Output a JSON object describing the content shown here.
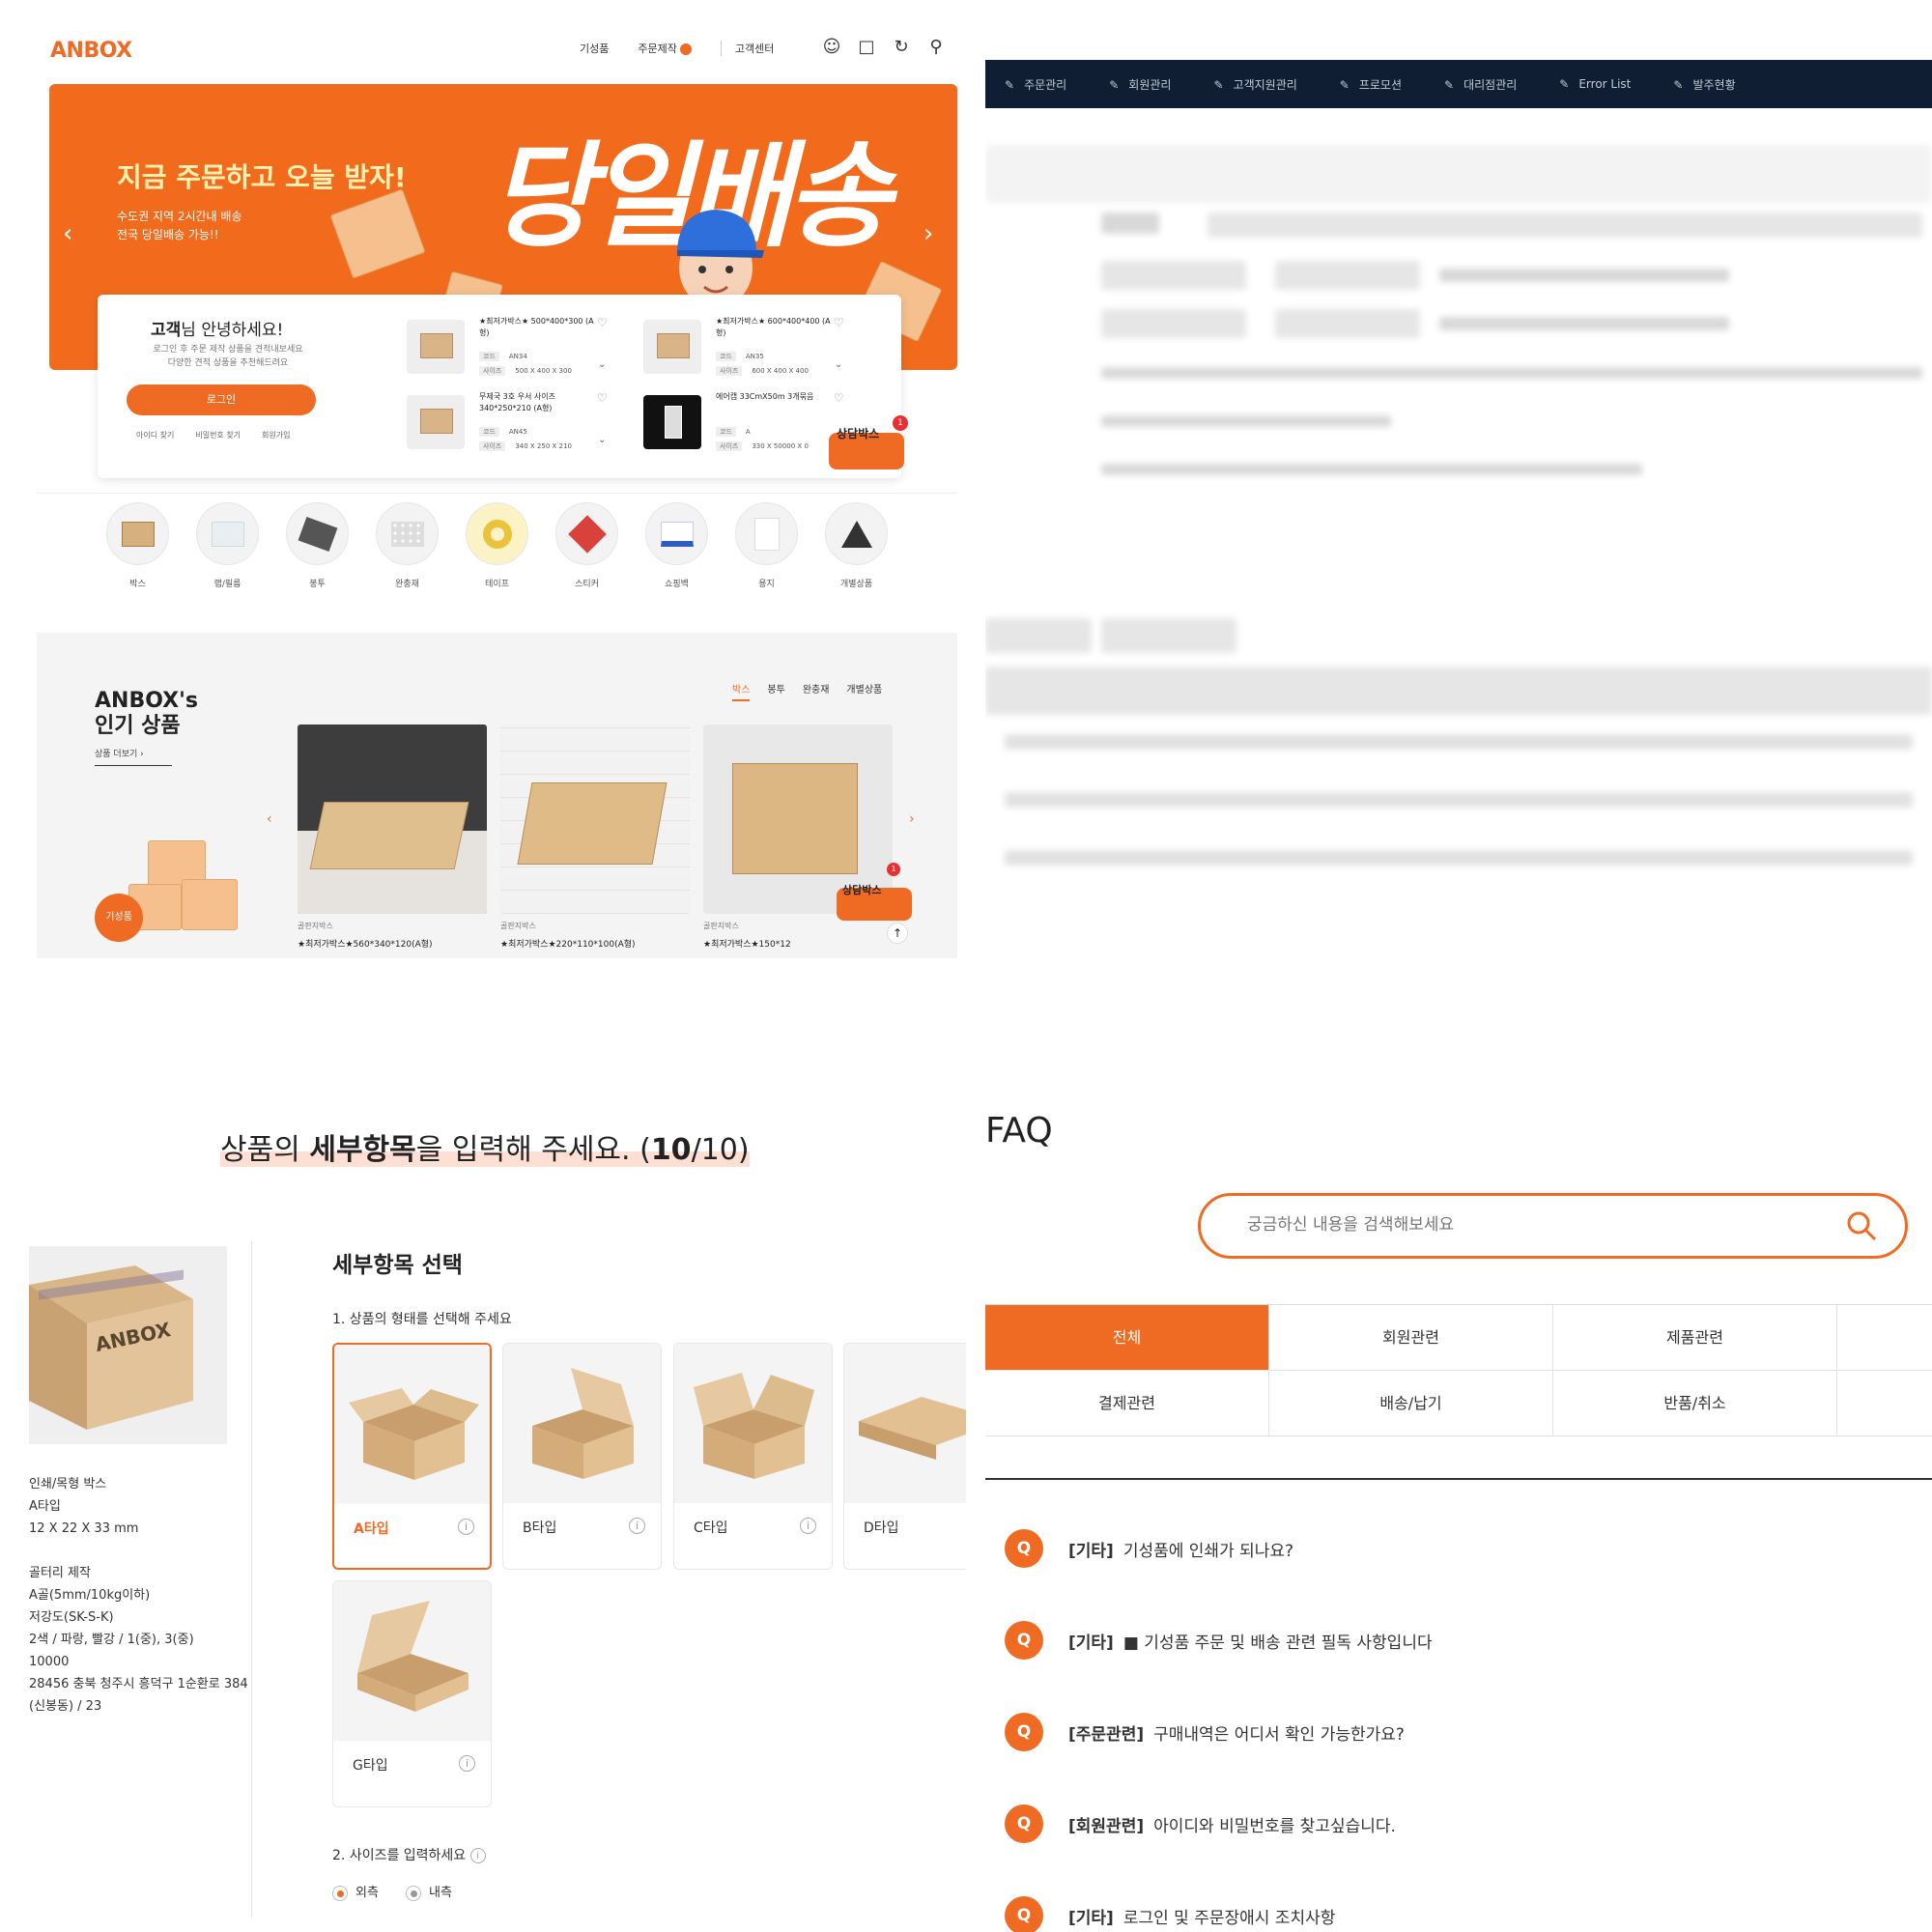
{
  "home": {
    "logo": "ANBOX",
    "nav": [
      "기성품",
      "주문제작",
      "고객센터"
    ],
    "banner": {
      "headline": "지금 주문하고 오늘 받자!",
      "sub": "수도권 지역 2시간내 배송\n전국 당일배송 가능!!",
      "big": "당일배송"
    },
    "login": {
      "greet_bold": "고객",
      "greet_rest": "님 안녕하세요!",
      "sub": "로그인 후 주문 제작 상품을 견적내보세요\n다양한 견적 상품을 추천해드려요",
      "button": "로그인",
      "links": [
        "아이디 찾기",
        "비밀번호 찾기",
        "회원가입"
      ]
    },
    "products": [
      {
        "title": "★최저가박스★ 500*400*300 (A형)",
        "code": "AN34",
        "size": "500 X 400 X 300"
      },
      {
        "title": "★최저가박스★ 600*400*400 (A형)",
        "code": "AN35",
        "size": "600 X 400 X 400"
      },
      {
        "title": "무제국 3호 우서 사이즈 340*250*210 (A형)",
        "code": "AN45",
        "size": "340 X 250 X 210"
      },
      {
        "title": "에어캡 33CmX50m 3개묶음",
        "code": "A",
        "size": "330 X 50000 X 0"
      }
    ],
    "meta_labels": {
      "code": "코드",
      "size": "사이즈"
    },
    "consult_badge": "상담박스",
    "notif_count": "1",
    "categories": [
      "박스",
      "랩/필름",
      "봉투",
      "완충재",
      "테이프",
      "스티커",
      "쇼핑백",
      "용지",
      "개별상품"
    ],
    "popular": {
      "title": "ANBOX's\n인기 상품",
      "more": "상품 더보기  ›",
      "tabs": [
        "박스",
        "봉투",
        "완충재",
        "개별상품"
      ],
      "giseong": "기성품",
      "items": [
        {
          "cat": "골판지박스",
          "name": "★최저가박스★560*340*120(A형)"
        },
        {
          "cat": "골판지박스",
          "name": "★최저가박스★220*110*100(A형)"
        },
        {
          "cat": "골판지박스",
          "name": "★최저가박스★150*12"
        }
      ]
    }
  },
  "admin": {
    "menu": [
      "주문관리",
      "회원관리",
      "고객지원관리",
      "프로모션",
      "대리점관리",
      "Error List",
      "발주현황"
    ]
  },
  "detail": {
    "title_pre": "상품의 ",
    "title_bold": "세부항목",
    "title_post": "을 입력해 주세요. (",
    "step_bold": "10",
    "step_rest": "/10)",
    "box_logo": "ANBOX",
    "side_info": "인쇄/목형 박스\nA타입\n12 X 22 X 33 mm\n\n골터리 제작\nA골(5mm/10kg이하)\n저강도(SK-S-K)\n2색 / 파랑, 빨강 / 1(중), 3(중)\n10000\n28456 충북 청주시 흥덕구 1순환로 384\n(신봉동) / 23",
    "select_heading": "세부항목 선택",
    "q1": "1. 상품의 형태를 선택해 주세요",
    "types": [
      "A타입",
      "B타입",
      "C타입",
      "D타입",
      "G타입"
    ],
    "q2": "2. 사이즈를 입력하세요",
    "radio": [
      "외측",
      "내측"
    ]
  },
  "faq": {
    "title": "FAQ",
    "search_placeholder": "궁금하신 내용을 검색해보세요",
    "tabs": [
      "전체",
      "회원관련",
      "제품관련",
      "결제관련",
      "배송/납기",
      "반품/취소"
    ],
    "items": [
      {
        "tag": "[기타]",
        "text": "기성품에 인쇄가 되나요?"
      },
      {
        "tag": "[기타]",
        "text": "■ 기성품 주문 및 배송 관련 필독 사항입니다"
      },
      {
        "tag": "[주문관련]",
        "text": "구매내역은 어디서 확인 가능한가요?"
      },
      {
        "tag": "[회원관련]",
        "text": "아이디와 비밀번호를 찾고싶습니다."
      },
      {
        "tag": "[기타]",
        "text": "로그인 및 주문장애시 조치사항"
      }
    ],
    "q_mark": "Q"
  },
  "colors": {
    "accent": "#ef6a22",
    "admin_bar": "#0f1e33"
  }
}
